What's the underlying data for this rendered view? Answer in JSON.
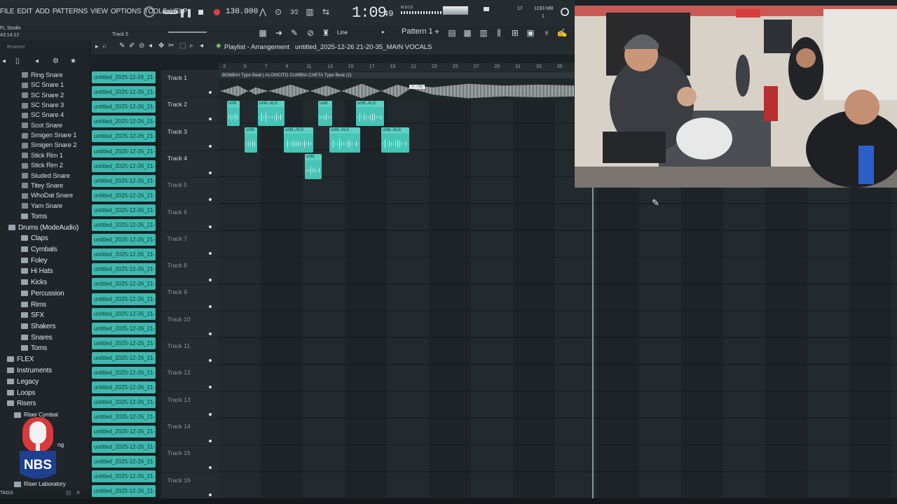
{
  "menu": [
    "FILE",
    "EDIT",
    "ADD",
    "PATTERNS",
    "VIEW",
    "OPTIONS",
    "TOOLS",
    "HELP"
  ],
  "transport": {
    "mode": "SONG",
    "tempo": "130.000",
    "time": "1:09",
    "time_small": "49",
    "time_label": "M:S:CS",
    "cpu": "17",
    "ram": "1193 MB",
    "ram_sub": "1"
  },
  "hint": {
    "app": "FL Studio",
    "clock": "43:14:12",
    "track_hint": "Track 5"
  },
  "toolbar": {
    "snap": "Line",
    "pattern": "Pattern 1"
  },
  "playlist": {
    "title": "Playlist - Arrangement",
    "file": "untitled_2025-12-26 21-20-35_MAIN VOCALS"
  },
  "browser": {
    "label": "Browser",
    "items": [
      "Ring Snare",
      "SC Snare 1",
      "SC Snare 2",
      "SC Snare 3",
      "SC Snare 4",
      "Scot Snare",
      "Smigen Snare 1",
      "Smigen Snare 2",
      "Stick Rim 1",
      "Stick Rim 2",
      "Studed Snare",
      "Titey Snare",
      "WhoDat Snare",
      "Yam Snare"
    ],
    "folders": [
      "Toms",
      "Drums (ModeAudio)",
      "Claps",
      "Cymbals",
      "Foley",
      "Hi Hats",
      "Kicks",
      "Percussion",
      "Rims",
      "SFX",
      "Shakers",
      "Snares",
      "Toms",
      "FLEX",
      "Instruments",
      "Legacy",
      "Loops",
      "Risers",
      "Riser Cymbal",
      "ng",
      "Riser Laboratory"
    ],
    "footer": "TAGS"
  },
  "pattern_clips": {
    "label": "untitled_2025-12-26_21-...",
    "count": 29
  },
  "tracks": [
    "Track 1",
    "Track 2",
    "Track 3",
    "Track 4",
    "Track 5",
    "Track 6",
    "Track 7",
    "Track 8",
    "Track 9",
    "Track 10",
    "Track 11",
    "Track 12",
    "Track 13",
    "Track 14",
    "Track 15",
    "Track 16"
  ],
  "ruler": [
    "3",
    "5",
    "7",
    "9",
    "11",
    "13",
    "15",
    "17",
    "19",
    "21",
    "23",
    "25",
    "27",
    "29",
    "31",
    "33",
    "35"
  ],
  "beat_clip": {
    "label": "BOMBAI Type Beat | ALONCITO CUMBIA CHETA Type Beat (2)",
    "marker": "-0.7dB"
  },
  "audio_clips": {
    "short": "untit..ALS",
    "tiny": "untit"
  },
  "logo": {
    "text": "NBS"
  },
  "colors": {
    "clip": "#3fb9ae",
    "bg": "#1e2428",
    "accent": "#d64545"
  }
}
